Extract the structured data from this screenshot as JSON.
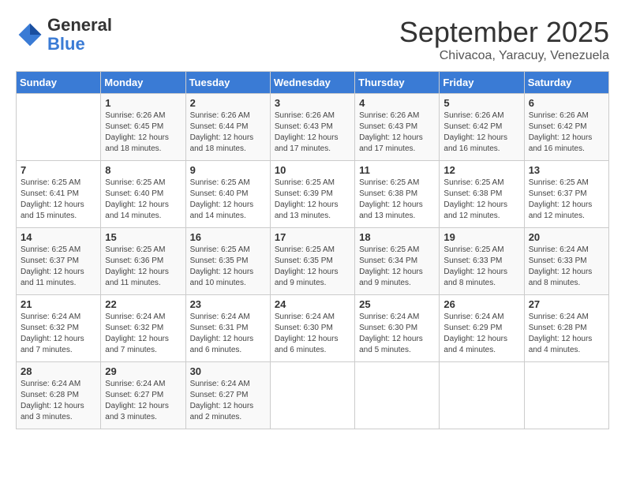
{
  "header": {
    "logo": {
      "general": "General",
      "blue": "Blue"
    },
    "title": "September 2025",
    "subtitle": "Chivacoa, Yaracuy, Venezuela"
  },
  "days_of_week": [
    "Sunday",
    "Monday",
    "Tuesday",
    "Wednesday",
    "Thursday",
    "Friday",
    "Saturday"
  ],
  "weeks": [
    [
      {
        "day": "",
        "info": ""
      },
      {
        "day": "1",
        "info": "Sunrise: 6:26 AM\nSunset: 6:45 PM\nDaylight: 12 hours\nand 18 minutes."
      },
      {
        "day": "2",
        "info": "Sunrise: 6:26 AM\nSunset: 6:44 PM\nDaylight: 12 hours\nand 18 minutes."
      },
      {
        "day": "3",
        "info": "Sunrise: 6:26 AM\nSunset: 6:43 PM\nDaylight: 12 hours\nand 17 minutes."
      },
      {
        "day": "4",
        "info": "Sunrise: 6:26 AM\nSunset: 6:43 PM\nDaylight: 12 hours\nand 17 minutes."
      },
      {
        "day": "5",
        "info": "Sunrise: 6:26 AM\nSunset: 6:42 PM\nDaylight: 12 hours\nand 16 minutes."
      },
      {
        "day": "6",
        "info": "Sunrise: 6:26 AM\nSunset: 6:42 PM\nDaylight: 12 hours\nand 16 minutes."
      }
    ],
    [
      {
        "day": "7",
        "info": "Sunrise: 6:25 AM\nSunset: 6:41 PM\nDaylight: 12 hours\nand 15 minutes."
      },
      {
        "day": "8",
        "info": "Sunrise: 6:25 AM\nSunset: 6:40 PM\nDaylight: 12 hours\nand 14 minutes."
      },
      {
        "day": "9",
        "info": "Sunrise: 6:25 AM\nSunset: 6:40 PM\nDaylight: 12 hours\nand 14 minutes."
      },
      {
        "day": "10",
        "info": "Sunrise: 6:25 AM\nSunset: 6:39 PM\nDaylight: 12 hours\nand 13 minutes."
      },
      {
        "day": "11",
        "info": "Sunrise: 6:25 AM\nSunset: 6:38 PM\nDaylight: 12 hours\nand 13 minutes."
      },
      {
        "day": "12",
        "info": "Sunrise: 6:25 AM\nSunset: 6:38 PM\nDaylight: 12 hours\nand 12 minutes."
      },
      {
        "day": "13",
        "info": "Sunrise: 6:25 AM\nSunset: 6:37 PM\nDaylight: 12 hours\nand 12 minutes."
      }
    ],
    [
      {
        "day": "14",
        "info": "Sunrise: 6:25 AM\nSunset: 6:37 PM\nDaylight: 12 hours\nand 11 minutes."
      },
      {
        "day": "15",
        "info": "Sunrise: 6:25 AM\nSunset: 6:36 PM\nDaylight: 12 hours\nand 11 minutes."
      },
      {
        "day": "16",
        "info": "Sunrise: 6:25 AM\nSunset: 6:35 PM\nDaylight: 12 hours\nand 10 minutes."
      },
      {
        "day": "17",
        "info": "Sunrise: 6:25 AM\nSunset: 6:35 PM\nDaylight: 12 hours\nand 9 minutes."
      },
      {
        "day": "18",
        "info": "Sunrise: 6:25 AM\nSunset: 6:34 PM\nDaylight: 12 hours\nand 9 minutes."
      },
      {
        "day": "19",
        "info": "Sunrise: 6:25 AM\nSunset: 6:33 PM\nDaylight: 12 hours\nand 8 minutes."
      },
      {
        "day": "20",
        "info": "Sunrise: 6:24 AM\nSunset: 6:33 PM\nDaylight: 12 hours\nand 8 minutes."
      }
    ],
    [
      {
        "day": "21",
        "info": "Sunrise: 6:24 AM\nSunset: 6:32 PM\nDaylight: 12 hours\nand 7 minutes."
      },
      {
        "day": "22",
        "info": "Sunrise: 6:24 AM\nSunset: 6:32 PM\nDaylight: 12 hours\nand 7 minutes."
      },
      {
        "day": "23",
        "info": "Sunrise: 6:24 AM\nSunset: 6:31 PM\nDaylight: 12 hours\nand 6 minutes."
      },
      {
        "day": "24",
        "info": "Sunrise: 6:24 AM\nSunset: 6:30 PM\nDaylight: 12 hours\nand 6 minutes."
      },
      {
        "day": "25",
        "info": "Sunrise: 6:24 AM\nSunset: 6:30 PM\nDaylight: 12 hours\nand 5 minutes."
      },
      {
        "day": "26",
        "info": "Sunrise: 6:24 AM\nSunset: 6:29 PM\nDaylight: 12 hours\nand 4 minutes."
      },
      {
        "day": "27",
        "info": "Sunrise: 6:24 AM\nSunset: 6:28 PM\nDaylight: 12 hours\nand 4 minutes."
      }
    ],
    [
      {
        "day": "28",
        "info": "Sunrise: 6:24 AM\nSunset: 6:28 PM\nDaylight: 12 hours\nand 3 minutes."
      },
      {
        "day": "29",
        "info": "Sunrise: 6:24 AM\nSunset: 6:27 PM\nDaylight: 12 hours\nand 3 minutes."
      },
      {
        "day": "30",
        "info": "Sunrise: 6:24 AM\nSunset: 6:27 PM\nDaylight: 12 hours\nand 2 minutes."
      },
      {
        "day": "",
        "info": ""
      },
      {
        "day": "",
        "info": ""
      },
      {
        "day": "",
        "info": ""
      },
      {
        "day": "",
        "info": ""
      }
    ]
  ]
}
